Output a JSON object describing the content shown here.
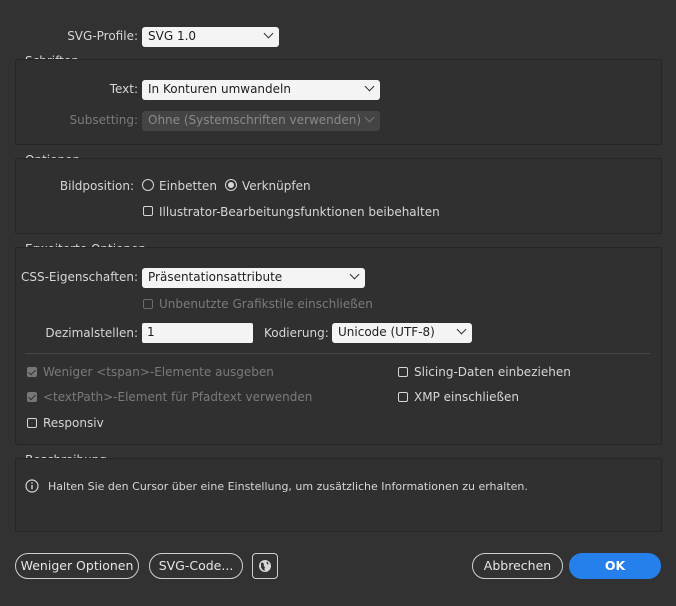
{
  "profile": {
    "label": "SVG-Profile:",
    "value": "SVG 1.0"
  },
  "fonts": {
    "title": "Schriften",
    "text_label": "Text:",
    "text_value": "In Konturen umwandeln",
    "subsetting_label": "Subsetting:",
    "subsetting_value": "Ohne (Systemschriften verwenden)"
  },
  "options": {
    "title": "Optionen",
    "image_label": "Bildposition:",
    "embed": "Einbetten",
    "link": "Verknüpfen",
    "preserve": "Illustrator-Bearbeitungsfunktionen beibehalten"
  },
  "advanced": {
    "title": "Erweiterte Optionen",
    "css_label": "CSS-Eigenschaften:",
    "css_value": "Präsentationsattribute",
    "unused_styles": "Unbenutzte Grafikstile einschließen",
    "decimal_label": "Dezimalstellen:",
    "decimal_value": "1",
    "encoding_label": "Kodierung:",
    "encoding_value": "Unicode (UTF-8)",
    "tspan": "Weniger <tspan>-Elemente ausgeben",
    "textpath": "<textPath>-Element für Pfadtext verwenden",
    "responsive": "Responsiv",
    "slicing": "Slicing-Daten einbeziehen",
    "xmp": "XMP einschließen"
  },
  "description": {
    "title": "Beschreibung",
    "text": "Halten Sie den Cursor über eine Einstellung, um zusätzliche Informationen zu erhalten."
  },
  "buttons": {
    "fewer": "Weniger Optionen",
    "svg_code": "SVG-Code...",
    "cancel": "Abbrechen",
    "ok": "OK"
  },
  "colors": {
    "accent": "#2680eb",
    "background": "#323232"
  }
}
